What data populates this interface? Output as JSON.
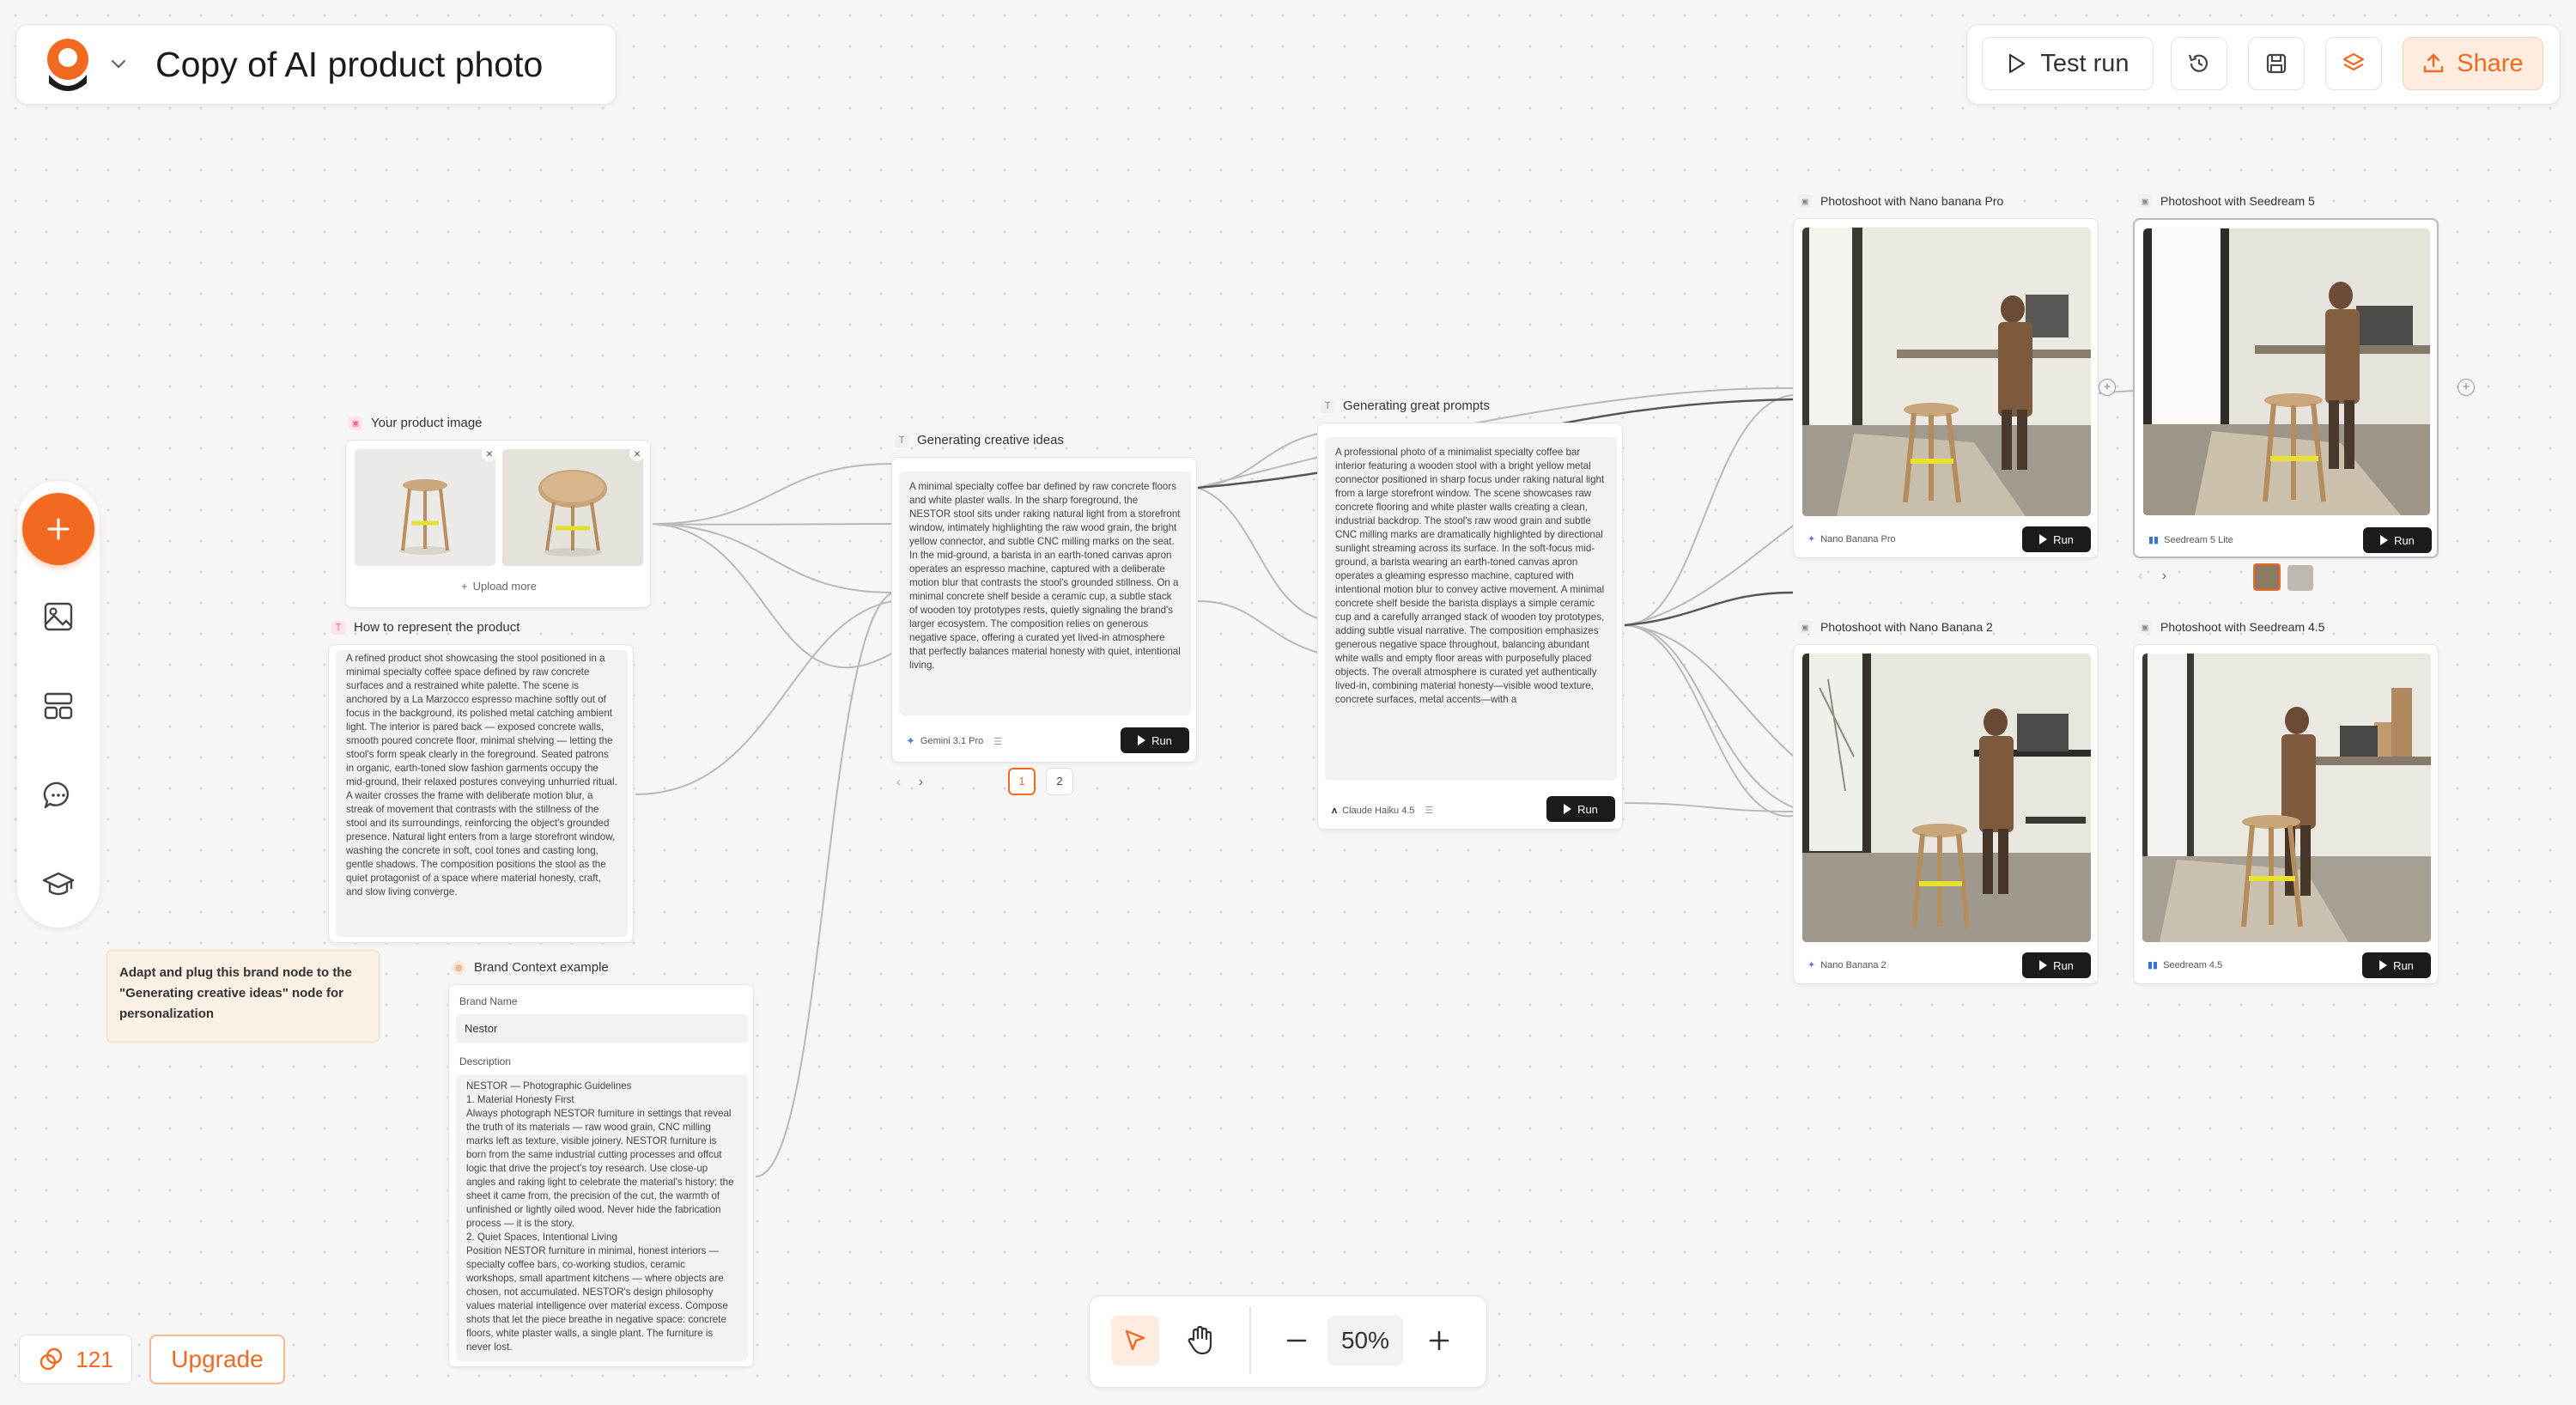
{
  "header": {
    "title": "Copy of AI product photo",
    "actions": {
      "test_run": "Test run",
      "share": "Share"
    }
  },
  "colors": {
    "accent": "#f26a21",
    "accent_soft": "#fdecdf",
    "dark": "#1b1b1d"
  },
  "nodes": {
    "product_image": {
      "title": "Your product image",
      "upload_more": "Upload more"
    },
    "represent": {
      "title": "How to represent the product",
      "text": "A refined product shot showcasing the stool positioned in a minimal specialty coffee space defined by raw concrete surfaces and a restrained white palette. The scene is anchored by a La Marzocco espresso machine softly out of focus in the background, its polished metal catching ambient light. The interior is pared back — exposed concrete walls, smooth poured concrete floor, minimal shelving — letting the stool's form speak clearly in the foreground. Seated patrons in organic, earth-toned slow fashion garments occupy the mid-ground, their relaxed postures conveying unhurried ritual. A waiter crosses the frame with deliberate motion blur, a streak of movement that contrasts with the stillness of the stool and its surroundings, reinforcing the object's grounded presence. Natural light enters from a large storefront window, washing the concrete in soft, cool tones and casting long, gentle shadows. The composition positions the stool as the quiet protagonist of a space where material honesty, craft, and slow living converge."
    },
    "note": {
      "text": "Adapt and plug this brand node to the \"Generating creative ideas\" node for personalization"
    },
    "brand": {
      "title": "Brand Context example",
      "brand_name_label": "Brand Name",
      "brand_name_value": "Nestor",
      "description_label": "Description",
      "description_text": "NESTOR — Photographic Guidelines\n1. Material Honesty First\nAlways photograph NESTOR furniture in settings that reveal the truth of its materials — raw wood grain, CNC milling marks left as texture, visible joinery. NESTOR furniture is born from the same industrial cutting processes and offcut logic that drive the project's toy research. Use close-up angles and raking light to celebrate the material's history: the sheet it came from, the precision of the cut, the warmth of unfinished or lightly oiled wood. Never hide the fabrication process — it is the story.\n2. Quiet Spaces, Intentional Living\nPosition NESTOR furniture in minimal, honest interiors — specialty coffee bars, co-working studios, ceramic workshops, small apartment kitchens — where objects are chosen, not accumulated. NESTOR's design philosophy values material intelligence over material excess. Compose shots that let the piece breathe in negative space: concrete floors, white plaster walls, a single plant. The furniture is never lost."
    },
    "creative": {
      "title": "Generating creative ideas",
      "text": "A minimal specialty coffee bar defined by raw concrete floors and white plaster walls. In the sharp foreground, the NESTOR stool sits under raking natural light from a storefront window, intimately highlighting the raw wood grain, the bright yellow connector, and subtle CNC milling marks on the seat. In the mid-ground, a barista in an earth-toned canvas apron operates an espresso machine, captured with a deliberate motion blur that contrasts the stool's grounded stillness. On a minimal concrete shelf beside a ceramic cup, a subtle stack of wooden toy prototypes rests, quietly signaling the brand's larger ecosystem. The composition relies on generous negative space, offering a curated yet lived-in atmosphere that perfectly balances material honesty with quiet, intentional living.",
      "model": "Gemini 3.1 Pro",
      "run": "Run",
      "pages": [
        "1",
        "2"
      ]
    },
    "prompts": {
      "title": "Generating great prompts",
      "text": "A professional photo of a minimalist specialty coffee bar interior featuring a wooden stool with a bright yellow metal connector positioned in sharp focus under raking natural light from a large storefront window. The scene showcases raw concrete flooring and white plaster walls creating a clean, industrial backdrop. The stool's raw wood grain and subtle CNC milling marks are dramatically highlighted by directional sunlight streaming across its surface. In the soft-focus mid-ground, a barista wearing an earth-toned canvas apron operates a gleaming espresso machine, captured with intentional motion blur to convey active movement. A minimal concrete shelf beside the barista displays a simple ceramic cup and a carefully arranged stack of wooden toy prototypes, adding subtle visual narrative. The composition emphasizes generous negative space throughout, balancing abundant white walls and empty floor areas with purposefully placed objects. The overall atmosphere is curated yet authentically lived-in, combining material honesty—visible wood texture, concrete surfaces, metal accents—with a",
      "model": "Claude Haiku 4.5",
      "run": "Run"
    },
    "shoot_nb_pro": {
      "title": "Photoshoot with Nano banana Pro",
      "model": "Nano Banana Pro",
      "run": "Run"
    },
    "shoot_sd5": {
      "title": "Photoshoot with Seedream 5",
      "model": "Seedream 5 Lite",
      "run": "Run"
    },
    "shoot_nb2": {
      "title": "Photoshoot with Nano Banana 2",
      "model": "Nano Banana 2",
      "run": "Run"
    },
    "shoot_sd45": {
      "title": "Photoshoot with Seedream 4.5",
      "model": "Seedream 4.5",
      "run": "Run"
    }
  },
  "footer": {
    "credits": "121",
    "upgrade": "Upgrade",
    "zoom": "50%"
  }
}
